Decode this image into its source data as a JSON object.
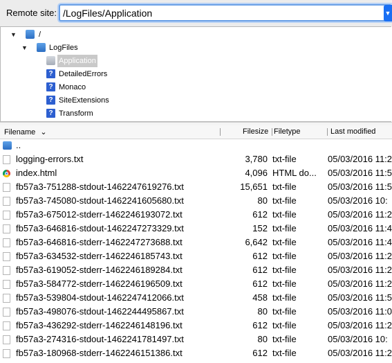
{
  "remote_site": {
    "label": "Remote site:",
    "path": "/LogFiles/Application"
  },
  "tree": [
    {
      "label": "/",
      "icon": "folder-icon"
    },
    {
      "label": "LogFiles",
      "icon": "folder-icon"
    },
    {
      "label": "Application",
      "icon": "folder-icon",
      "selected": true
    },
    {
      "label": "DetailedErrors",
      "icon": "unknown-folder-icon"
    },
    {
      "label": "Monaco",
      "icon": "unknown-folder-icon"
    },
    {
      "label": "SiteExtensions",
      "icon": "unknown-folder-icon"
    },
    {
      "label": "Transform",
      "icon": "unknown-folder-icon"
    }
  ],
  "columns": {
    "filename": "Filename",
    "filesize": "Filesize",
    "filetype": "Filetype",
    "modified": "Last modified"
  },
  "files": [
    {
      "name": "..",
      "size": "",
      "type": "",
      "modified": "",
      "icon": "folder-icon"
    },
    {
      "name": "logging-errors.txt",
      "size": "3,780",
      "type": "txt-file",
      "modified": "05/03/2016 11:2",
      "icon": "file-icon"
    },
    {
      "name": "index.html",
      "size": "4,096",
      "type": "HTML do...",
      "modified": "05/03/2016 11:5",
      "icon": "chrome-icon"
    },
    {
      "name": "fb57a3-751288-stdout-1462247619276.txt",
      "size": "15,651",
      "type": "txt-file",
      "modified": "05/03/2016 11:5",
      "icon": "file-icon"
    },
    {
      "name": "fb57a3-745080-stdout-1462241605680.txt",
      "size": "80",
      "type": "txt-file",
      "modified": "05/03/2016 10:",
      "icon": "file-icon"
    },
    {
      "name": "fb57a3-675012-stderr-1462246193072.txt",
      "size": "612",
      "type": "txt-file",
      "modified": "05/03/2016 11:2",
      "icon": "file-icon"
    },
    {
      "name": "fb57a3-646816-stdout-1462247273329.txt",
      "size": "152",
      "type": "txt-file",
      "modified": "05/03/2016 11:4",
      "icon": "file-icon"
    },
    {
      "name": "fb57a3-646816-stderr-1462247273688.txt",
      "size": "6,642",
      "type": "txt-file",
      "modified": "05/03/2016 11:4",
      "icon": "file-icon"
    },
    {
      "name": "fb57a3-634532-stderr-1462246185743.txt",
      "size": "612",
      "type": "txt-file",
      "modified": "05/03/2016 11:2",
      "icon": "file-icon"
    },
    {
      "name": "fb57a3-619052-stderr-1462246189284.txt",
      "size": "612",
      "type": "txt-file",
      "modified": "05/03/2016 11:2",
      "icon": "file-icon"
    },
    {
      "name": "fb57a3-584772-stderr-1462246196509.txt",
      "size": "612",
      "type": "txt-file",
      "modified": "05/03/2016 11:2",
      "icon": "file-icon"
    },
    {
      "name": "fb57a3-539804-stdout-1462247412066.txt",
      "size": "458",
      "type": "txt-file",
      "modified": "05/03/2016 11:5",
      "icon": "file-icon"
    },
    {
      "name": "fb57a3-498076-stdout-1462244495867.txt",
      "size": "80",
      "type": "txt-file",
      "modified": "05/03/2016 11:0",
      "icon": "file-icon"
    },
    {
      "name": "fb57a3-436292-stderr-1462246148196.txt",
      "size": "612",
      "type": "txt-file",
      "modified": "05/03/2016 11:2",
      "icon": "file-icon"
    },
    {
      "name": "fb57a3-274316-stdout-1462241781497.txt",
      "size": "80",
      "type": "txt-file",
      "modified": "05/03/2016 10:",
      "icon": "file-icon"
    },
    {
      "name": "fb57a3-180968-stderr-1462246151386.txt",
      "size": "612",
      "type": "txt-file",
      "modified": "05/03/2016 11:2",
      "icon": "file-icon"
    }
  ]
}
